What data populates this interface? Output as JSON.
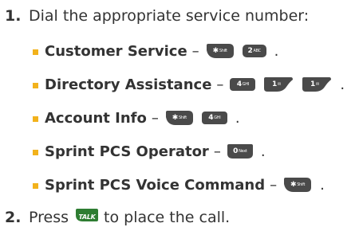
{
  "steps": [
    {
      "number": "1.",
      "text": "Dial the appropriate service number:"
    },
    {
      "number": "2.",
      "pre": "Press",
      "post": "to place the call."
    }
  ],
  "bullets": [
    {
      "label": "Customer Service",
      "keys": [
        {
          "icon": "star-key-icon",
          "main": "✱",
          "sub": "Shift"
        },
        {
          "icon": "2-key-icon",
          "main": "2",
          "sub": "ABC"
        }
      ]
    },
    {
      "label": "Directory Assistance",
      "keys": [
        {
          "icon": "4-key-icon",
          "main": "4",
          "sub": "GHI"
        },
        {
          "icon": "1-key-icon",
          "main": "1",
          "sub": "✉"
        },
        {
          "icon": "1-key-icon",
          "main": "1",
          "sub": "✉"
        }
      ]
    },
    {
      "label": "Account Info",
      "keys": [
        {
          "icon": "star-key-icon",
          "main": "✱",
          "sub": "Shift"
        },
        {
          "icon": "4-key-icon",
          "main": "4",
          "sub": "GHI"
        }
      ]
    },
    {
      "label": "Sprint PCS Operator",
      "keys": [
        {
          "icon": "0-key-icon",
          "main": "0",
          "sub": "Next"
        }
      ]
    },
    {
      "label": "Sprint PCS Voice Command",
      "keys": [
        {
          "icon": "star-key-icon",
          "main": "✱",
          "sub": "Shift"
        }
      ]
    }
  ],
  "dash": "–",
  "period": ".",
  "talk_key": {
    "icon": "talk-key-icon",
    "label": "TALK"
  },
  "colors": {
    "bullet": "#f2b21c",
    "key_dark": "#4a4a4a",
    "talk_key": "#2e7d32"
  }
}
